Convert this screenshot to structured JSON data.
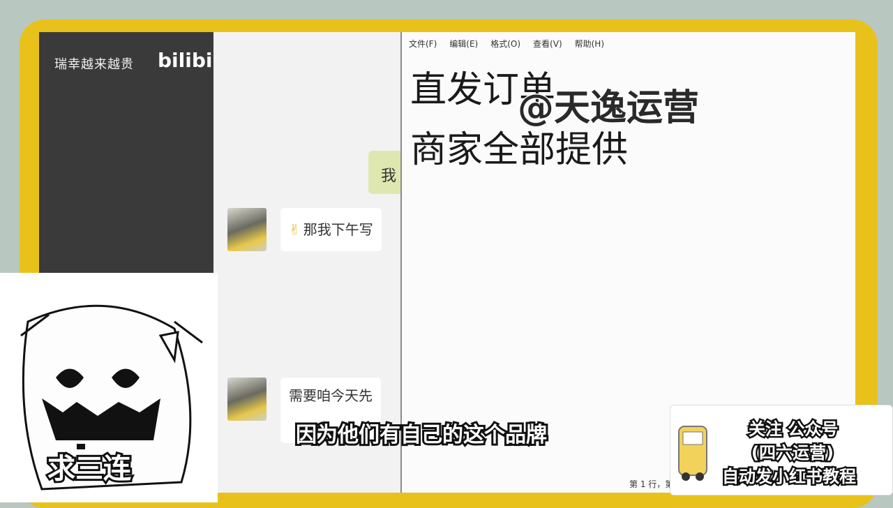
{
  "left_panel": {
    "title": "瑞幸越来越贵",
    "logo": "bilibili"
  },
  "chat": {
    "self_message": "我",
    "messages": [
      {
        "emoji": "✌",
        "text": "那我下午写"
      },
      {
        "text": "需要咱今天先"
      }
    ]
  },
  "notepad": {
    "menu": [
      "文件(F)",
      "编辑(E)",
      "格式(O)",
      "查看(V)",
      "帮助(H)"
    ],
    "lines": [
      "直发订单",
      "商家全部提供"
    ],
    "watermark": "@天逸运营",
    "status": "第 1 行，第"
  },
  "sticker": {
    "caption": "求三连"
  },
  "subtitle": "因为他们有自己的这个品牌",
  "promo": {
    "line1": "关注 公众号",
    "line2": "(四六运营)",
    "line3": "自动发小红书教程"
  }
}
